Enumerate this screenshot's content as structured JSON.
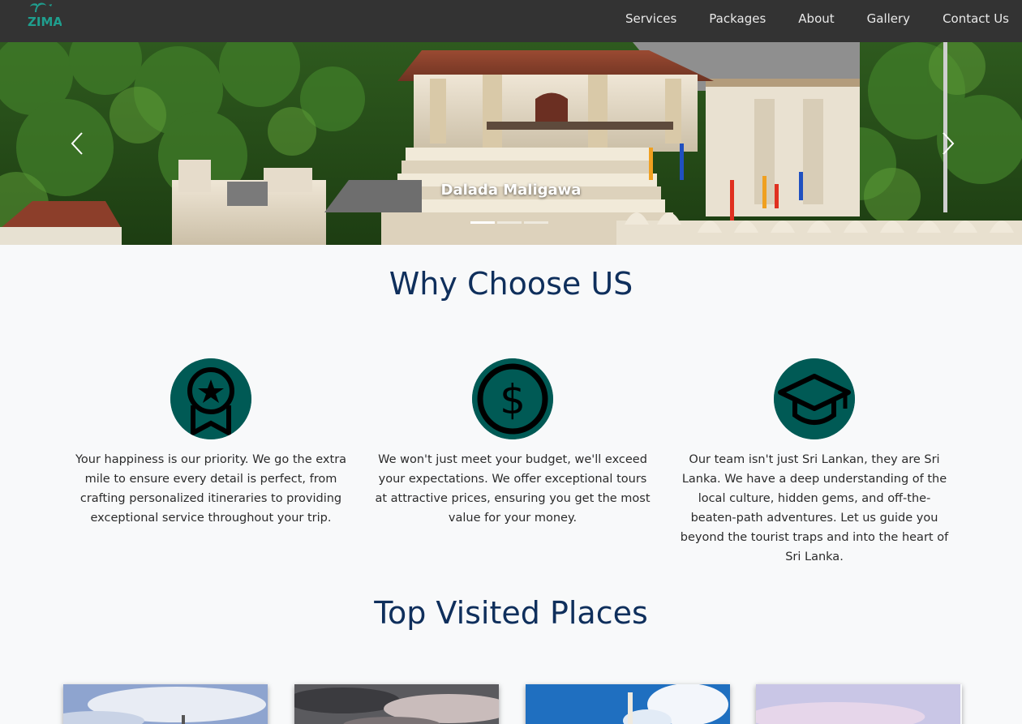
{
  "navbar": {
    "logo_text": "ZIMA",
    "links": [
      "Services",
      "Packages",
      "About",
      "Gallery",
      "Contact Us"
    ]
  },
  "hero": {
    "caption": "Dalada Maligawa",
    "prev_icon": "chevron-left-icon",
    "next_icon": "chevron-right-icon",
    "slide_count": 3,
    "active_slide": 1
  },
  "why_choose": {
    "title": "Why Choose US",
    "features": [
      {
        "icon": "award-badge-icon",
        "text": "Your happiness is our priority. We go the extra mile to ensure every detail is perfect, from crafting personalized itineraries to providing exceptional service throughout your trip."
      },
      {
        "icon": "dollar-coin-icon",
        "text": "We won't just meet your budget, we'll exceed your expectations. We offer exceptional tours at attractive prices, ensuring you get the most value for your money."
      },
      {
        "icon": "graduation-cap-icon",
        "text": "Our team isn't just Sri Lankan, they are Sri Lanka. We have a deep understanding of the local culture, hidden gems, and off-the-beaten-path adventures. Let us guide you beyond the tourist traps and into the heart of Sri Lanka."
      }
    ]
  },
  "top_places": {
    "title": "Top Visited Places"
  },
  "colors": {
    "navbar_bg": "#333333",
    "heading": "#0f2f5c",
    "icon_circle": "#005a55",
    "page_bg": "#f8f9fa"
  }
}
